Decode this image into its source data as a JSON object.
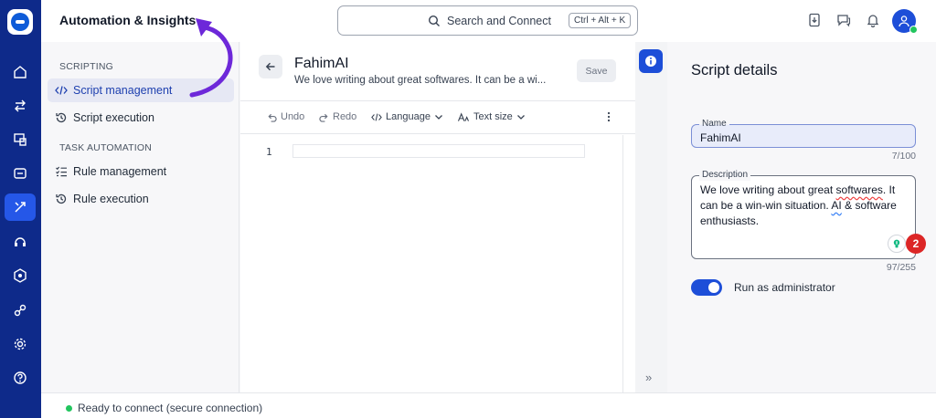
{
  "header": {
    "title": "Automation & Insights",
    "search_label": "Search and Connect",
    "search_shortcut": "Ctrl + Alt + K"
  },
  "nav": {
    "sections": [
      {
        "title": "SCRIPTING",
        "items": [
          {
            "label": "Script management",
            "icon": "code-icon",
            "active": true
          },
          {
            "label": "Script execution",
            "icon": "history-icon",
            "active": false
          }
        ]
      },
      {
        "title": "TASK AUTOMATION",
        "items": [
          {
            "label": "Rule management",
            "icon": "checklist-icon",
            "active": false
          },
          {
            "label": "Rule execution",
            "icon": "history-icon",
            "active": false
          }
        ]
      }
    ]
  },
  "editor": {
    "script_name": "FahimAI",
    "script_description": "We love writing about great softwares. It can be a wi...",
    "save_label": "Save",
    "toolbar": {
      "undo": "Undo",
      "redo": "Redo",
      "language": "Language",
      "text_size": "Text size"
    },
    "line_number": "1"
  },
  "details": {
    "title": "Script details",
    "name_label": "Name",
    "name_value": "FahimAI",
    "name_counter": "7/100",
    "description_label": "Description",
    "description_part1": "We love writing about great ",
    "description_word_misspelled": "softwares",
    "description_part2": ". It can be a win-win situation. ",
    "description_word_flagged": "AI",
    "description_part3": " & software enthusiasts.",
    "description_counter": "97/255",
    "grammar_badge_count": "2",
    "run_as_admin_label": "Run as administrator",
    "run_as_admin_enabled": true
  },
  "status": {
    "text": "Ready to connect (secure connection)"
  },
  "colors": {
    "rail": "#0e2a8a",
    "accent": "#1d4ed8",
    "annotation_arrow": "#6d28d9",
    "status_ok": "#22c55e",
    "badge_red": "#dc2626"
  }
}
